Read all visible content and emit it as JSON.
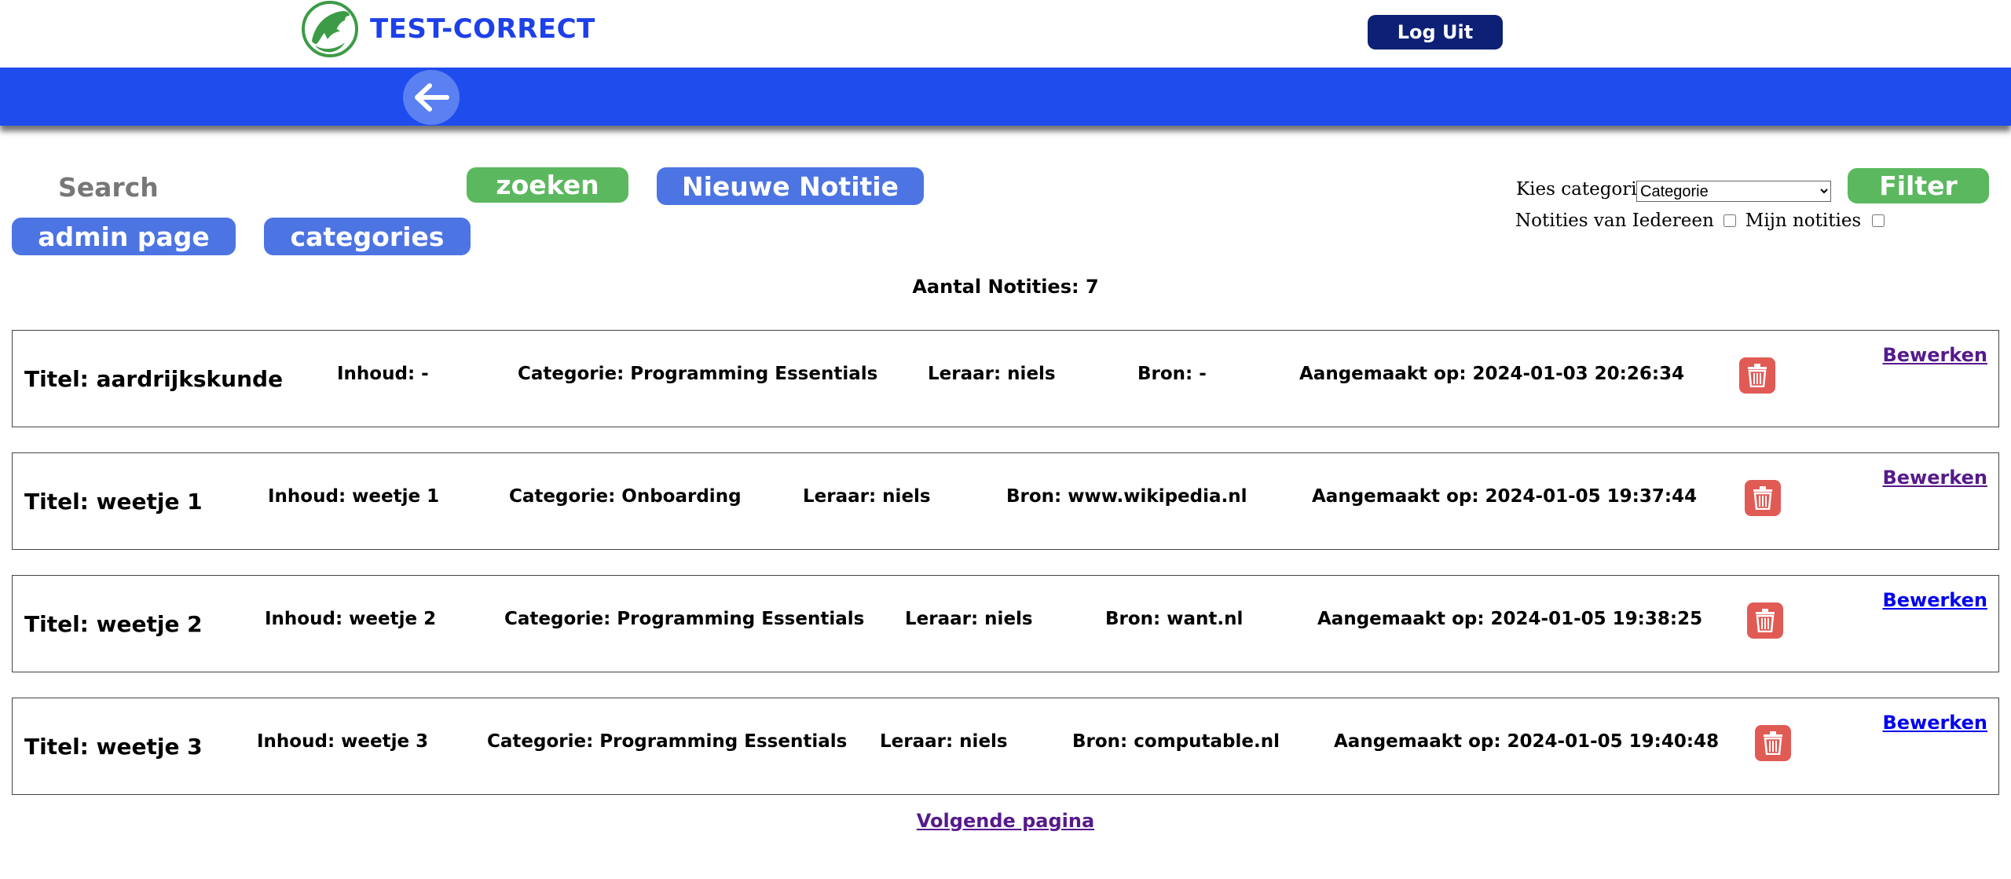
{
  "header": {
    "logo_text": "TEST-CORRECT",
    "logout_label": "Log Uit",
    "brand_color": "#1f4ced"
  },
  "toolbar": {
    "search_placeholder": "Search",
    "search_label": "zoeken",
    "new_note_label": "Nieuwe Notitie",
    "admin_label": "admin page",
    "categories_label": "categories",
    "filter": {
      "category_label": "Kies categorie:",
      "category_selected": "Categorie",
      "filter_label": "Filter",
      "everyone_label": "Notities van Iedereen",
      "mine_label": "Mijn notities"
    }
  },
  "count_text": "Aantal Notities: 7",
  "notes": [
    {
      "title": "Titel: aardrijkskunde",
      "inhoud": "Inhoud: -",
      "categorie": "Categorie: Programming Essentials",
      "leraar": "Leraar: niels",
      "bron": "Bron: -",
      "aangemaakt": "Aangemaakt op: 2024-01-03 20:26:34",
      "edit": "Bewerken"
    },
    {
      "title": "Titel: weetje 1",
      "inhoud": "Inhoud: weetje 1",
      "categorie": "Categorie: Onboarding",
      "leraar": "Leraar: niels",
      "bron": "Bron: www.wikipedia.nl",
      "aangemaakt": "Aangemaakt op: 2024-01-05 19:37:44",
      "edit": "Bewerken"
    },
    {
      "title": "Titel: weetje 2",
      "inhoud": "Inhoud: weetje 2",
      "categorie": "Categorie: Programming Essentials",
      "leraar": "Leraar: niels",
      "bron": "Bron: want.nl",
      "aangemaakt": "Aangemaakt op: 2024-01-05 19:38:25",
      "edit": "Bewerken"
    },
    {
      "title": "Titel: weetje 3",
      "inhoud": "Inhoud: weetje 3",
      "categorie": "Categorie: Programming Essentials",
      "leraar": "Leraar: niels",
      "bron": "Bron: computable.nl",
      "aangemaakt": "Aangemaakt op: 2024-01-05 19:40:48",
      "edit": "Bewerken"
    }
  ],
  "pagination": {
    "next_label": "Volgende pagina"
  },
  "icons": {
    "logo": "dolphin-logo-icon",
    "back": "arrow-left-icon",
    "delete": "trash-icon"
  }
}
